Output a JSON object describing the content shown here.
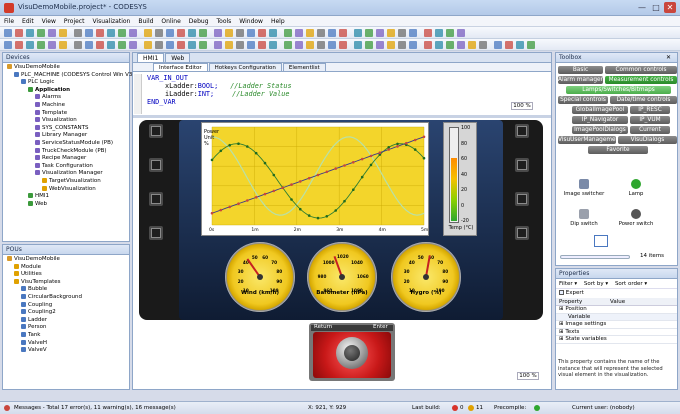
{
  "app": {
    "title": "VisuDemoMobile.project* - CODESYS"
  },
  "menu": [
    "File",
    "Edit",
    "View",
    "Project",
    "Visualization",
    "Build",
    "Online",
    "Debug",
    "Tools",
    "Window",
    "Help"
  ],
  "devices": {
    "title": "Devices",
    "items": [
      {
        "label": "VisuDemoMobile",
        "level": 0
      },
      {
        "label": "PLC_MACHINE (CODESYS Control Win V3)",
        "level": 1
      },
      {
        "label": "PLC Logic",
        "level": 2
      },
      {
        "label": "Application",
        "level": 3
      },
      {
        "label": "Alarms",
        "level": 4
      },
      {
        "label": "Machine",
        "level": 4
      },
      {
        "label": "Template",
        "level": 4
      },
      {
        "label": "Visualization",
        "level": 4
      },
      {
        "label": "SYS_CONSTANTS",
        "level": 4
      },
      {
        "label": "Library Manager",
        "level": 4
      },
      {
        "label": "ServiceStatusModule (PB)",
        "level": 4
      },
      {
        "label": "TruckCheckModule (PB)",
        "level": 4
      },
      {
        "label": "Recipe Manager",
        "level": 4
      },
      {
        "label": "Task Configuration",
        "level": 4
      },
      {
        "label": "Visualization Manager",
        "level": 4
      },
      {
        "label": "TargetVisualization",
        "level": 5
      },
      {
        "label": "WebVisualization",
        "level": 5
      },
      {
        "label": "HMI1",
        "level": 3
      },
      {
        "label": "Web",
        "level": 3
      }
    ]
  },
  "pous": {
    "title": "POUs",
    "items": [
      {
        "label": "VisuDemoMobile",
        "level": 0
      },
      {
        "label": "Module",
        "level": 1
      },
      {
        "label": "Utilities",
        "level": 1
      },
      {
        "label": "VisuTemplates",
        "level": 1
      },
      {
        "label": "Bubble",
        "level": 2
      },
      {
        "label": "CircularBackground",
        "level": 2
      },
      {
        "label": "Coupling",
        "level": 2
      },
      {
        "label": "Coupling2",
        "level": 2
      },
      {
        "label": "Ladder",
        "level": 2
      },
      {
        "label": "Person",
        "level": 2
      },
      {
        "label": "Tank",
        "level": 2
      },
      {
        "label": "ValveH",
        "level": 2
      },
      {
        "label": "ValveV",
        "level": 2
      }
    ]
  },
  "doc_tabs": [
    "HMI1",
    "Web"
  ],
  "editor_tabs": [
    "Interface Editor",
    "Hotkeys Configuration",
    "Elementlist"
  ],
  "code": {
    "l1": "VAR_IN_OUT",
    "l2_var": "xLadder:",
    "l2_type": "BOOL;",
    "l2_cmt": "//Ladder Status",
    "l3_var": "iLadder:",
    "l3_type": "INT;",
    "l3_cmt": "//Ladder Value",
    "l4": "END_VAR"
  },
  "zoom_top": "100 %",
  "zoom_bottom": "100 %",
  "chart_labels": {
    "ylabel1": "Power",
    "ylabel2": "Unit",
    "ylabel3": "%",
    "x_ticks": [
      "0s",
      "1m",
      "2m",
      "3m",
      "4m",
      "5m"
    ]
  },
  "thermo": {
    "label": "Temp (°C)",
    "ticks": [
      "100",
      "80",
      "60",
      "40",
      "20",
      "0",
      "-20"
    ],
    "level": 0.67
  },
  "gauges": [
    {
      "label": "Wind (km/h)",
      "ticks": [
        "10",
        "20",
        "30",
        "40",
        "50",
        "60",
        "70",
        "80",
        "90",
        "100"
      ]
    },
    {
      "label": "Barometer (hPa)",
      "ticks": [
        "960",
        "980",
        "1000",
        "1020",
        "1040",
        "1060",
        "1080"
      ]
    },
    {
      "label": "Hygro (%)",
      "ticks": [
        "10",
        "20",
        "30",
        "40",
        "50",
        "60",
        "70",
        "80",
        "90",
        "100"
      ]
    }
  ],
  "buttons": {
    "return": "Return",
    "enter": "Enter"
  },
  "toolbox": {
    "title": "Toolbox",
    "cats": [
      {
        "label": "Basic",
        "style": "gray"
      },
      {
        "label": "Common controls",
        "style": "gray"
      },
      {
        "label": "Alarm manager",
        "style": "gray"
      },
      {
        "label": "Measurement controls",
        "style": "green"
      },
      {
        "label": "Lamps/Switches/Bitmaps",
        "style": "lightgreen"
      },
      {
        "label": "Special controls",
        "style": "gray"
      },
      {
        "label": "Date/time controls",
        "style": "gray"
      },
      {
        "label": "GlobalImagePool",
        "style": "gray"
      },
      {
        "label": "IP_RESC",
        "style": "gray"
      },
      {
        "label": "IP_Navigator",
        "style": "gray"
      },
      {
        "label": "IP_VUM",
        "style": "gray"
      },
      {
        "label": "ImagePoolDialogs",
        "style": "gray"
      },
      {
        "label": "Current project",
        "style": "gray"
      },
      {
        "label": "VisuUserManagement",
        "style": "gray"
      },
      {
        "label": "VisuDialogs",
        "style": "gray"
      },
      {
        "label": "Favorite",
        "style": "gray"
      }
    ],
    "elements": [
      "Image switcher",
      "Lamp",
      "Dip switch",
      "Power switch"
    ],
    "item_count": "14 items"
  },
  "properties": {
    "title": "Properties",
    "filter": "Filter",
    "sort_by": "Sort by",
    "sort_order": "Sort order",
    "expert": "Expert",
    "col_property": "Property",
    "col_value": "Value",
    "rows": [
      "Position",
      "Variable",
      "Image settings",
      "Texts",
      "State variables"
    ],
    "description": "This property contains the name of the instance that will represent the selected visual element in the visualization."
  },
  "status": {
    "messages": "Messages - Total 17 error(s), 11 warning(s), 16 message(s)",
    "coords": "X: 921, Y: 929",
    "last_build": "Last build:",
    "errors": "0",
    "warnings": "11",
    "precompile": "Precompile:",
    "user": "Current user: (nobody)"
  },
  "colors": {
    "accent": "#2a8a2a",
    "panel": "#1b2a45",
    "chart_bg": "#f3d52b",
    "gauge": "#f0c820"
  }
}
